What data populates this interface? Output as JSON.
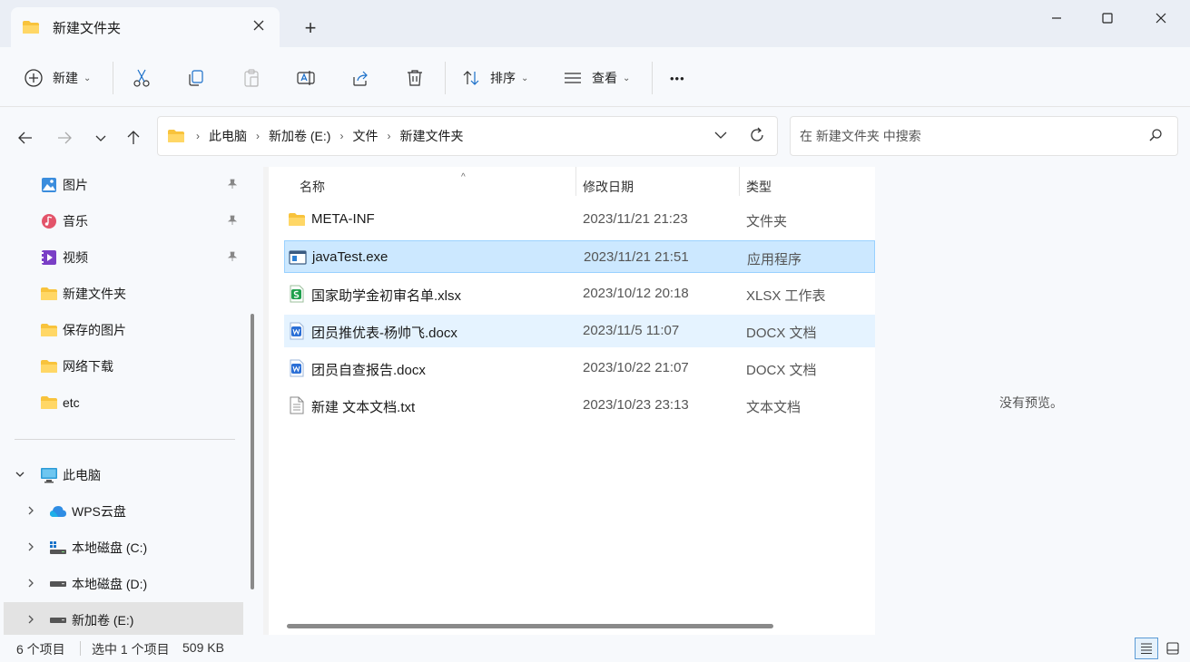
{
  "window": {
    "tab_title": "新建文件夹",
    "new_tab_symbol": "+"
  },
  "toolbar": {
    "new_label": "新建",
    "sort_label": "排序",
    "view_label": "查看",
    "more_label": "•••"
  },
  "address": {
    "crumbs": [
      "此电脑",
      "新加卷 (E:)",
      "文件",
      "新建文件夹"
    ],
    "search_placeholder": "在 新建文件夹 中搜索"
  },
  "sidebar": {
    "items": [
      {
        "label": "图片",
        "icon": "pictures-icon",
        "pinned": true
      },
      {
        "label": "音乐",
        "icon": "music-icon",
        "pinned": true
      },
      {
        "label": "视频",
        "icon": "videos-icon",
        "pinned": true
      },
      {
        "label": "新建文件夹",
        "icon": "folder-icon"
      },
      {
        "label": "保存的图片",
        "icon": "folder-icon"
      },
      {
        "label": "网络下载",
        "icon": "folder-icon"
      },
      {
        "label": "etc",
        "icon": "folder-icon"
      },
      {
        "label": "此电脑",
        "icon": "computer-icon",
        "expanded": true
      },
      {
        "label": "WPS云盘",
        "icon": "cloud-icon"
      },
      {
        "label": "本地磁盘 (C:)",
        "icon": "drive-c-icon"
      },
      {
        "label": "本地磁盘 (D:)",
        "icon": "drive-icon"
      },
      {
        "label": "新加卷 (E:)",
        "icon": "drive-icon",
        "selected": true
      }
    ]
  },
  "files": {
    "columns": [
      "名称",
      "修改日期",
      "类型"
    ],
    "rows": [
      {
        "name": "META-INF",
        "date": "2023/11/21 21:23",
        "type": "文件夹",
        "icon": "folder-icon"
      },
      {
        "name": "javaTest.exe",
        "date": "2023/11/21 21:51",
        "type": "应用程序",
        "icon": "exe-icon",
        "selected": true
      },
      {
        "name": "国家助学金初审名单.xlsx",
        "date": "2023/10/12 20:18",
        "type": "XLSX 工作表",
        "icon": "xlsx-icon"
      },
      {
        "name": "团员推优表-杨帅飞.docx",
        "date": "2023/11/5 11:07",
        "type": "DOCX 文档",
        "icon": "docx-icon",
        "hover": true
      },
      {
        "name": "团员自查报告.docx",
        "date": "2023/10/22 21:07",
        "type": "DOCX 文档",
        "icon": "docx-icon"
      },
      {
        "name": "新建 文本文档.txt",
        "date": "2023/10/23 23:13",
        "type": "文本文档",
        "icon": "txt-icon"
      }
    ]
  },
  "preview": {
    "text": "没有预览。"
  },
  "status": {
    "count": "6 个项目",
    "selection": "选中 1 个项目",
    "size": "509 KB"
  },
  "colors": {
    "selected_row": "#cce8ff",
    "hover_row": "#e5f3ff",
    "folder": "#f8c33c",
    "accent": "#0067c0"
  }
}
